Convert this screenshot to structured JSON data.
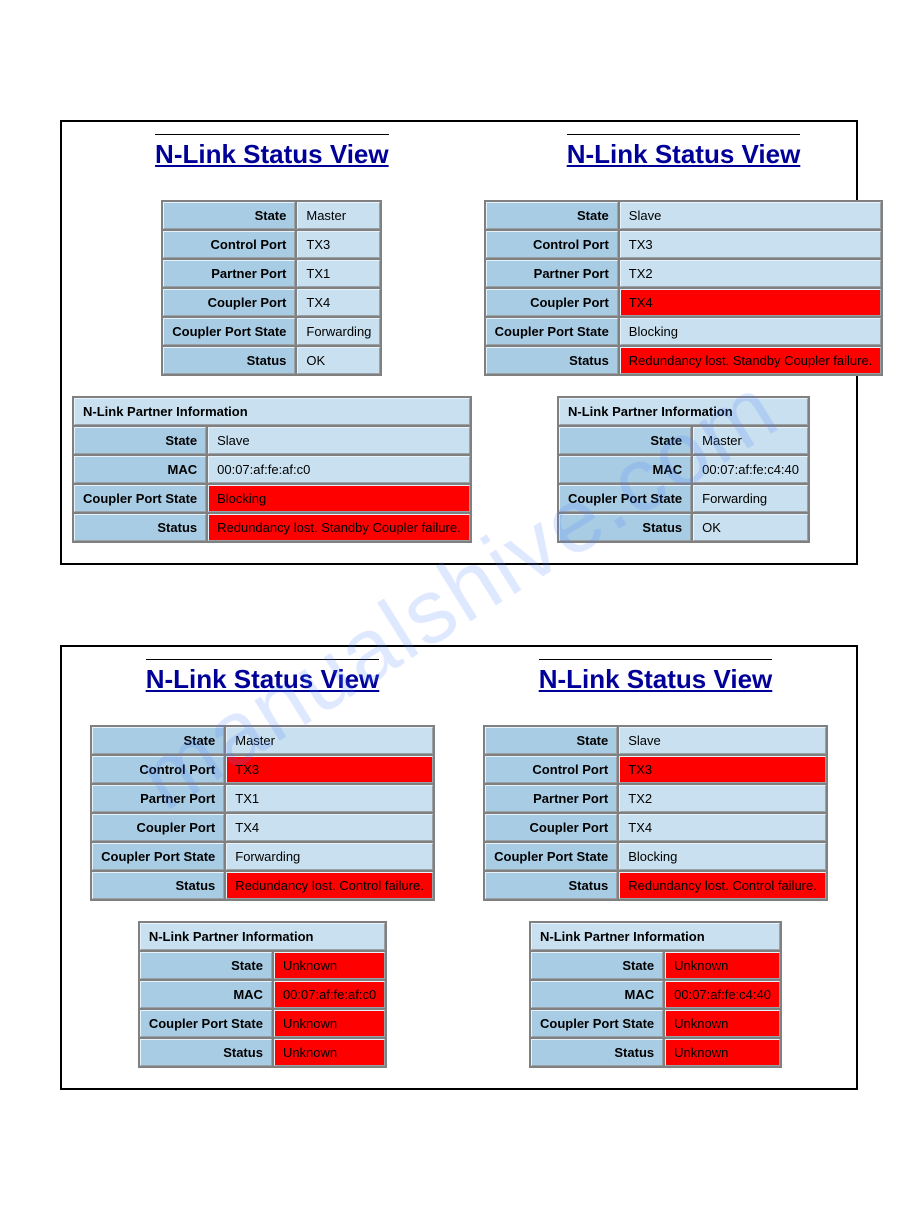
{
  "watermark": "manualshive.com",
  "title": "N-Link Status View",
  "partner_header": "N-Link Partner Information",
  "labels": {
    "state": "State",
    "control_port": "Control Port",
    "partner_port": "Partner Port",
    "coupler_port": "Coupler Port",
    "coupler_port_state": "Coupler Port State",
    "status": "Status",
    "mac": "MAC"
  },
  "panels": [
    {
      "cols": [
        {
          "main": {
            "state": {
              "v": "Master",
              "alert": false
            },
            "control_port": {
              "v": "TX3",
              "alert": false
            },
            "partner_port": {
              "v": "TX1",
              "alert": false
            },
            "coupler_port": {
              "v": "TX4",
              "alert": false
            },
            "coupler_port_state": {
              "v": "Forwarding",
              "alert": false
            },
            "status": {
              "v": "OK",
              "alert": false
            }
          },
          "partner": {
            "state": {
              "v": "Slave",
              "alert": false
            },
            "mac": {
              "v": "00:07:af:fe:af:c0",
              "alert": false
            },
            "coupler_port_state": {
              "v": "Blocking",
              "alert": true
            },
            "status": {
              "v": "Redundancy lost. Standby Coupler failure.",
              "alert": true
            }
          }
        },
        {
          "main": {
            "state": {
              "v": "Slave",
              "alert": false
            },
            "control_port": {
              "v": "TX3",
              "alert": false
            },
            "partner_port": {
              "v": "TX2",
              "alert": false
            },
            "coupler_port": {
              "v": "TX4",
              "alert": true
            },
            "coupler_port_state": {
              "v": "Blocking",
              "alert": false
            },
            "status": {
              "v": "Redundancy lost. Standby Coupler failure.",
              "alert": true
            }
          },
          "partner": {
            "state": {
              "v": "Master",
              "alert": false
            },
            "mac": {
              "v": "00:07:af:fe:c4:40",
              "alert": false
            },
            "coupler_port_state": {
              "v": "Forwarding",
              "alert": false
            },
            "status": {
              "v": "OK",
              "alert": false
            }
          }
        }
      ]
    },
    {
      "cols": [
        {
          "main": {
            "state": {
              "v": "Master",
              "alert": false
            },
            "control_port": {
              "v": "TX3",
              "alert": true
            },
            "partner_port": {
              "v": "TX1",
              "alert": false
            },
            "coupler_port": {
              "v": "TX4",
              "alert": false
            },
            "coupler_port_state": {
              "v": "Forwarding",
              "alert": false
            },
            "status": {
              "v": "Redundancy lost. Control failure.",
              "alert": true
            }
          },
          "partner": {
            "state": {
              "v": "Unknown",
              "alert": true
            },
            "mac": {
              "v": "00:07:af:fe:af:c0",
              "alert": true
            },
            "coupler_port_state": {
              "v": "Unknown",
              "alert": true
            },
            "status": {
              "v": "Unknown",
              "alert": true
            }
          }
        },
        {
          "main": {
            "state": {
              "v": "Slave",
              "alert": false
            },
            "control_port": {
              "v": "TX3",
              "alert": true
            },
            "partner_port": {
              "v": "TX2",
              "alert": false
            },
            "coupler_port": {
              "v": "TX4",
              "alert": false
            },
            "coupler_port_state": {
              "v": "Blocking",
              "alert": false
            },
            "status": {
              "v": "Redundancy lost. Control failure.",
              "alert": true
            }
          },
          "partner": {
            "state": {
              "v": "Unknown",
              "alert": true
            },
            "mac": {
              "v": "00:07:af:fe:c4:40",
              "alert": true
            },
            "coupler_port_state": {
              "v": "Unknown",
              "alert": true
            },
            "status": {
              "v": "Unknown",
              "alert": true
            }
          }
        }
      ]
    }
  ]
}
